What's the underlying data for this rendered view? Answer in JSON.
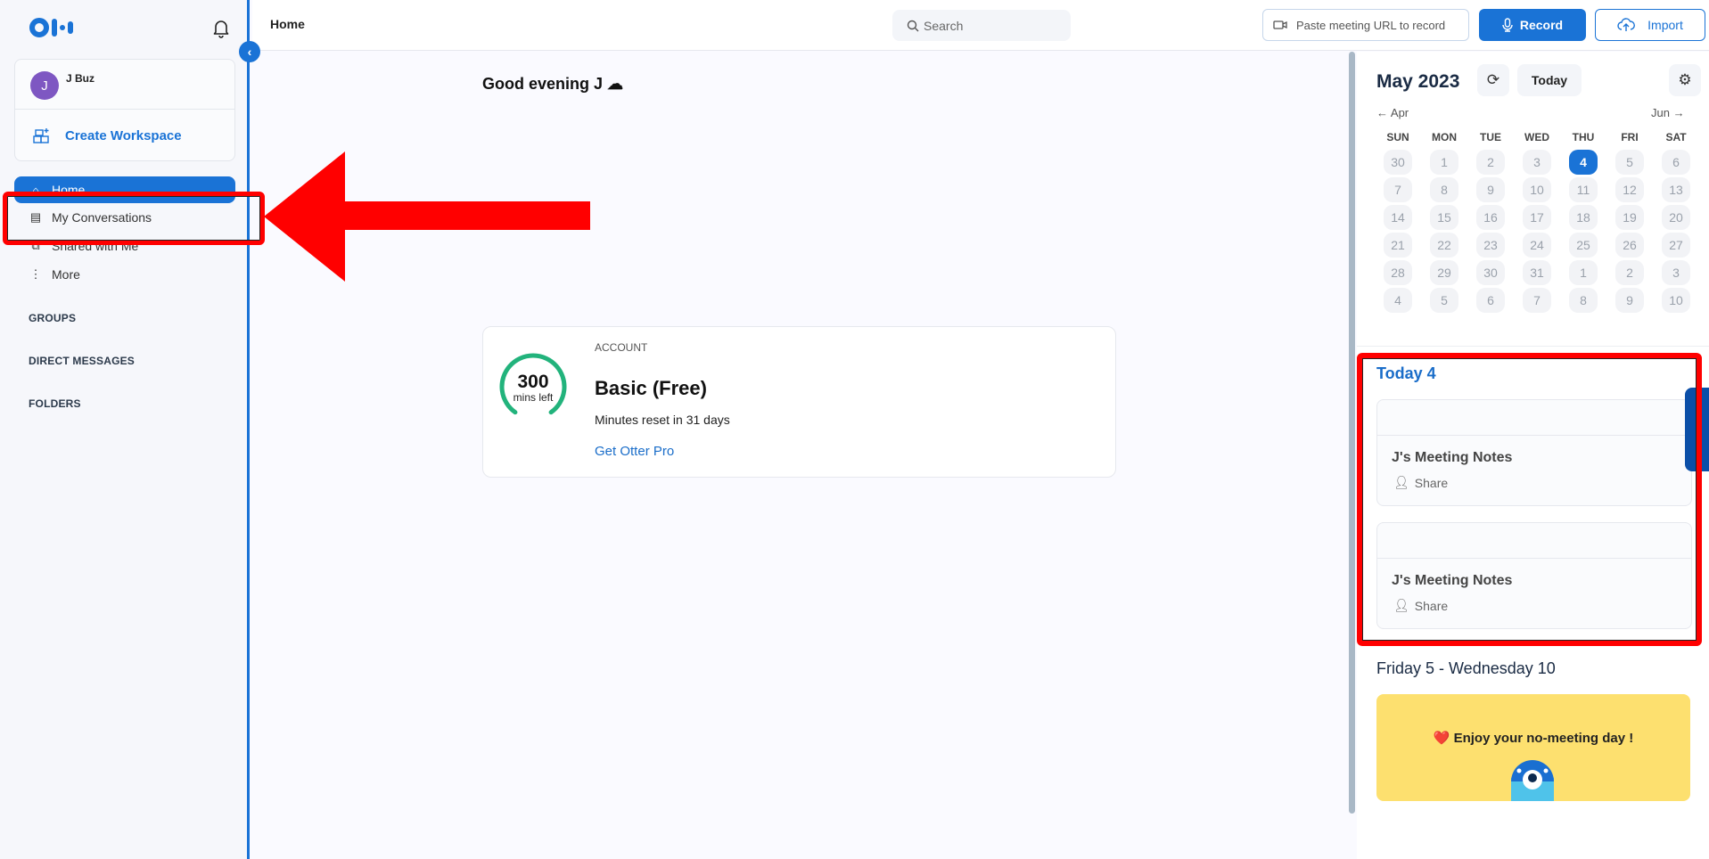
{
  "app": {
    "brand": "Otter",
    "accent_color": "#1a73d6"
  },
  "sidebar": {
    "account": {
      "avatar_initial": "J",
      "name": "J Buz",
      "avatar_color": "#7e57c2"
    },
    "create_workspace_label": "Create Workspace",
    "nav_items": [
      {
        "label": "Home",
        "icon": "home-icon",
        "active": true
      },
      {
        "label": "My Conversations",
        "icon": "document-icon",
        "active": false
      },
      {
        "label": "Shared with Me",
        "icon": "shared-icon",
        "active": false
      },
      {
        "label": "More",
        "icon": "more-vertical-icon",
        "active": false
      }
    ],
    "sections": [
      "GROUPS",
      "DIRECT MESSAGES",
      "FOLDERS"
    ]
  },
  "topbar": {
    "page_title": "Home",
    "search_placeholder": "Search",
    "paste_url_placeholder": "Paste meeting URL to record",
    "record_label": "Record",
    "import_label": "Import"
  },
  "main": {
    "greeting": "Good evening J",
    "plan_card": {
      "section_label": "ACCOUNT",
      "minutes_left": "300",
      "minutes_label": "mins left",
      "plan_name": "Basic (Free)",
      "reset_text": "Minutes reset in 31 days",
      "upgrade_link": "Get Otter Pro",
      "gauge_fill_fraction": 1.0
    }
  },
  "calendar": {
    "month_title": "May 2023",
    "today_button": "Today",
    "prev_month": "← Apr",
    "next_month": "Jun →",
    "weekdays": [
      "SUN",
      "MON",
      "TUE",
      "WED",
      "THU",
      "FRI",
      "SAT"
    ],
    "days": [
      "30",
      "1",
      "2",
      "3",
      "4",
      "5",
      "6",
      "7",
      "8",
      "9",
      "10",
      "11",
      "12",
      "13",
      "14",
      "15",
      "16",
      "17",
      "18",
      "19",
      "20",
      "21",
      "22",
      "23",
      "24",
      "25",
      "26",
      "27",
      "28",
      "29",
      "30",
      "31",
      "1",
      "2",
      "3",
      "4",
      "5",
      "6",
      "7",
      "8",
      "9",
      "10"
    ],
    "today_index": 4
  },
  "agenda": {
    "today_heading": "Today 4",
    "meetings": [
      {
        "title": "J's Meeting Notes",
        "share_label": "Share"
      },
      {
        "title": "J's Meeting Notes",
        "share_label": "Share"
      }
    ],
    "range_heading": "Friday 5 - Wednesday 10",
    "no_meeting_text": "Enjoy your no-meeting day !",
    "no_meeting_emoji": "❤️"
  },
  "annotations": {
    "highlight_color": "#ff0000"
  }
}
